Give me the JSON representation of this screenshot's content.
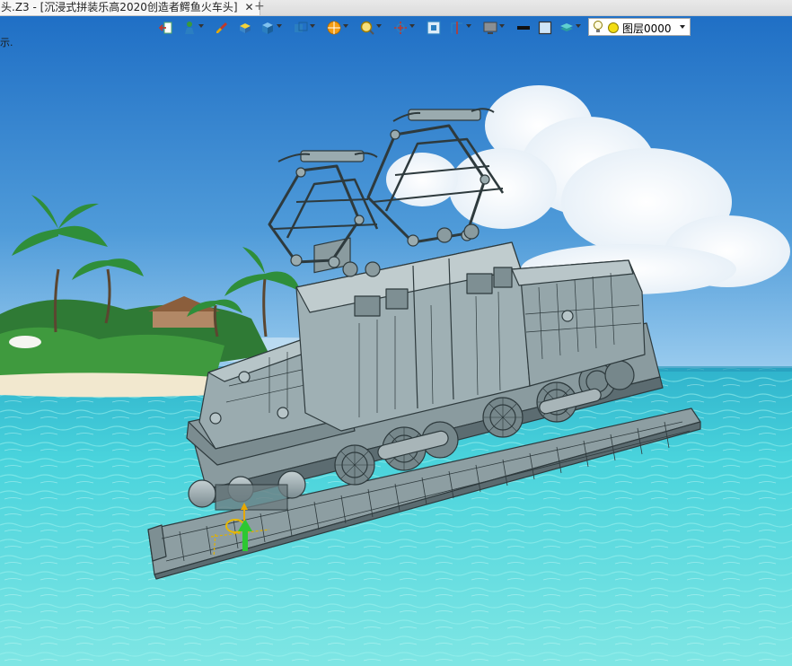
{
  "window": {
    "tab_title": "头.Z3 - [沉浸式拼装乐高2020创造者鳄鱼火车头]",
    "close_glyph": "✕",
    "add_tab_glyph": "+"
  },
  "viewport": {
    "hint_text": "示."
  },
  "toolbar": {
    "buttons": [
      {
        "id": "exit",
        "icon": "exit-arrow-icon",
        "dropdown": false
      },
      {
        "id": "display",
        "icon": "figure-display-icon",
        "dropdown": true
      },
      {
        "id": "brush",
        "icon": "paintbrush-icon",
        "dropdown": false
      },
      {
        "id": "shaded",
        "icon": "shaded-box-icon",
        "dropdown": false
      },
      {
        "id": "solid",
        "icon": "blue-cube-icon",
        "dropdown": true
      },
      {
        "id": "views",
        "icon": "cube-views-icon",
        "dropdown": true
      },
      {
        "id": "render",
        "icon": "render-sphere-icon",
        "dropdown": true
      },
      {
        "id": "zoom",
        "icon": "zoom-lens-icon",
        "dropdown": true
      },
      {
        "id": "rotate",
        "icon": "rotate-axes-icon",
        "dropdown": true
      },
      {
        "id": "frame",
        "icon": "frame-view-icon",
        "dropdown": false
      },
      {
        "id": "section",
        "icon": "section-icon",
        "dropdown": true
      },
      {
        "id": "monitor",
        "icon": "monitor-icon",
        "dropdown": true
      },
      {
        "id": "line",
        "icon": "line-weight-icon",
        "dropdown": false
      },
      {
        "id": "box",
        "icon": "box-outline-icon",
        "dropdown": false
      },
      {
        "id": "stack",
        "icon": "layer-stack-icon",
        "dropdown": true
      }
    ],
    "layer_combo": {
      "value": "图层0000"
    }
  },
  "colors": {
    "sky_top": "#1f74c9",
    "sky_horizon": "#7fb9e6",
    "sea": "#39c8d6",
    "sea_deep": "#1e9fb3",
    "model_gray": "#8fa0a4",
    "model_edge": "#2e3a3d"
  }
}
